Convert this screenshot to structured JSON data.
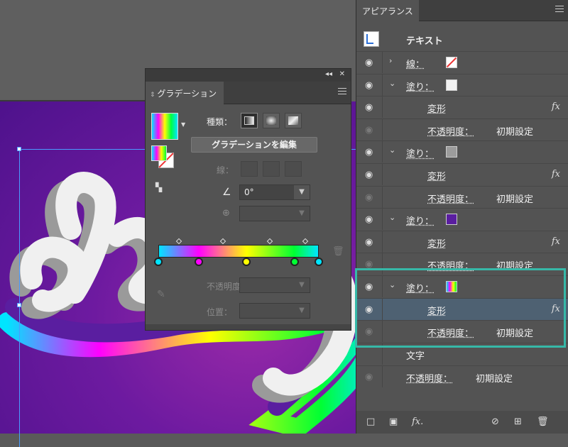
{
  "artwork": {
    "colors": {
      "artboard": "#6d1aa0",
      "letters": "#f0f0f0",
      "shadow": "#9a9a9a"
    }
  },
  "gradient_panel": {
    "title": "グラデーション",
    "type_label": "種類：",
    "edit_button": "グラデーションを編集",
    "stroke_label": "線：",
    "angle_value": "0°",
    "opacity_label": "不透明度：",
    "position_label": "位置：",
    "stops": [
      {
        "color": "#00e5ff",
        "location": 0
      },
      {
        "color": "#ff00ff",
        "location": 0.25
      },
      {
        "color": "#ffff00",
        "location": 0.55
      },
      {
        "color": "#00ff33",
        "location": 0.85
      },
      {
        "color": "#00e5ff",
        "location": 1.0
      }
    ]
  },
  "appearance_panel": {
    "title": "アピアランス",
    "object_name": "テキスト",
    "rows": [
      {
        "type": "stroke",
        "label": "線：",
        "swatch": "#ffffff",
        "swatch_kind": "none"
      },
      {
        "type": "fill",
        "label": "塗り：",
        "swatch": "#f2f2f2"
      },
      {
        "type": "effect",
        "label": "変形"
      },
      {
        "type": "opacity",
        "label": "不透明度：",
        "value": "初期設定"
      },
      {
        "type": "fill",
        "label": "塗り：",
        "swatch": "#9c9c9c"
      },
      {
        "type": "effect",
        "label": "変形"
      },
      {
        "type": "opacity",
        "label": "不透明度：",
        "value": "初期設定"
      },
      {
        "type": "fill",
        "label": "塗り：",
        "swatch": "#5a1ea0"
      },
      {
        "type": "effect",
        "label": "変形"
      },
      {
        "type": "opacity",
        "label": "不透明度：",
        "value": "初期設定"
      },
      {
        "type": "fill",
        "label": "塗り：",
        "swatch": "gradient"
      },
      {
        "type": "effect",
        "label": "変形"
      },
      {
        "type": "opacity",
        "label": "不透明度：",
        "value": "初期設定"
      },
      {
        "type": "chars",
        "label": "文字"
      },
      {
        "type": "opacity",
        "label": "不透明度：",
        "value": "初期設定"
      }
    ],
    "fx_label": "fx",
    "highlight_color": "#4e6172",
    "callout_color": "#36b8a8"
  }
}
